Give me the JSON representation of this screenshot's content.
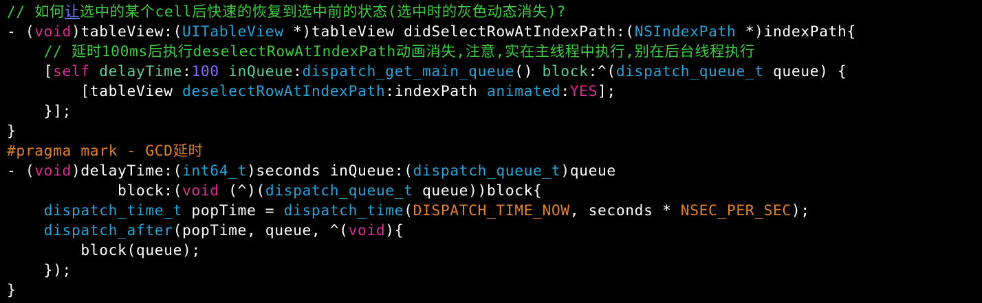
{
  "editor": {
    "colors": {
      "background": "#000000",
      "plain": "#ffffff",
      "comment": "#41cc45",
      "keyword": "#d82f95",
      "type": "#2aa4d6",
      "directive": "#e0822c",
      "number": "#8a6cf4",
      "link": "#6d7cf4",
      "label": "#5fd09a"
    },
    "lines": [
      [
        {
          "t": "// 如何",
          "k": "comment"
        },
        {
          "t": "让",
          "k": "link"
        },
        {
          "t": "选中的某个cell后快速的恢复到选中前的状态(选中时的灰色动态消失)?",
          "k": "comment"
        }
      ],
      [
        {
          "t": "- (",
          "k": "plain"
        },
        {
          "t": "void",
          "k": "keyword"
        },
        {
          "t": ")tableView:(",
          "k": "plain"
        },
        {
          "t": "UITableView",
          "k": "type"
        },
        {
          "t": " *)tableView didSelectRowAtIndexPath:(",
          "k": "plain"
        },
        {
          "t": "NSIndexPath",
          "k": "type"
        },
        {
          "t": " *)indexPath{",
          "k": "plain"
        }
      ],
      [
        {
          "t": "    ",
          "k": "plain"
        },
        {
          "t": "// 延时100ms后执行deselectRowAtIndexPath动画消失,注意,实在主线程中执行,别在后台线程执行",
          "k": "comment"
        }
      ],
      [
        {
          "t": "    [",
          "k": "plain"
        },
        {
          "t": "self",
          "k": "keyword"
        },
        {
          "t": " ",
          "k": "plain"
        },
        {
          "t": "delayTime",
          "k": "label"
        },
        {
          "t": ":",
          "k": "plain"
        },
        {
          "t": "100",
          "k": "number"
        },
        {
          "t": " ",
          "k": "plain"
        },
        {
          "t": "inQueue",
          "k": "label"
        },
        {
          "t": ":",
          "k": "plain"
        },
        {
          "t": "dispatch_get_main_queue",
          "k": "sys"
        },
        {
          "t": "() ",
          "k": "plain"
        },
        {
          "t": "block",
          "k": "label"
        },
        {
          "t": ":^(",
          "k": "plain"
        },
        {
          "t": "dispatch_queue_t",
          "k": "type"
        },
        {
          "t": " queue) {",
          "k": "plain"
        }
      ],
      [
        {
          "t": "        [tableView ",
          "k": "plain"
        },
        {
          "t": "deselectRowAtIndexPath",
          "k": "sys"
        },
        {
          "t": ":indexPath ",
          "k": "plain"
        },
        {
          "t": "animated",
          "k": "sys"
        },
        {
          "t": ":",
          "k": "plain"
        },
        {
          "t": "YES",
          "k": "keyword"
        },
        {
          "t": "];",
          "k": "plain"
        }
      ],
      [
        {
          "t": "    }];",
          "k": "plain"
        }
      ],
      [
        {
          "t": "}",
          "k": "plain"
        }
      ],
      [
        {
          "t": "#pragma mark - GCD延时",
          "k": "directive"
        }
      ],
      [
        {
          "t": "- (",
          "k": "plain"
        },
        {
          "t": "void",
          "k": "keyword"
        },
        {
          "t": ")delayTime:(",
          "k": "plain"
        },
        {
          "t": "int64_t",
          "k": "type"
        },
        {
          "t": ")seconds inQueue:(",
          "k": "plain"
        },
        {
          "t": "dispatch_queue_t",
          "k": "type"
        },
        {
          "t": ")queue",
          "k": "plain"
        }
      ],
      [
        {
          "t": "            block:(",
          "k": "plain"
        },
        {
          "t": "void",
          "k": "keyword"
        },
        {
          "t": " (^)(",
          "k": "plain"
        },
        {
          "t": "dispatch_queue_t",
          "k": "type"
        },
        {
          "t": " queue))block{",
          "k": "plain"
        }
      ],
      [
        {
          "t": "    ",
          "k": "plain"
        },
        {
          "t": "dispatch_time_t",
          "k": "type"
        },
        {
          "t": " popTime = ",
          "k": "plain"
        },
        {
          "t": "dispatch_time",
          "k": "sys"
        },
        {
          "t": "(",
          "k": "plain"
        },
        {
          "t": "DISPATCH_TIME_NOW",
          "k": "macro"
        },
        {
          "t": ", seconds * ",
          "k": "plain"
        },
        {
          "t": "NSEC_PER_SEC",
          "k": "macro"
        },
        {
          "t": ");",
          "k": "plain"
        }
      ],
      [
        {
          "t": "    ",
          "k": "plain"
        },
        {
          "t": "dispatch_after",
          "k": "sys"
        },
        {
          "t": "(popTime, queue, ^(",
          "k": "plain"
        },
        {
          "t": "void",
          "k": "keyword"
        },
        {
          "t": "){",
          "k": "plain"
        }
      ],
      [
        {
          "t": "        block(queue);",
          "k": "plain"
        }
      ],
      [
        {
          "t": "    });",
          "k": "plain"
        }
      ],
      [
        {
          "t": "}",
          "k": "plain"
        }
      ]
    ]
  }
}
